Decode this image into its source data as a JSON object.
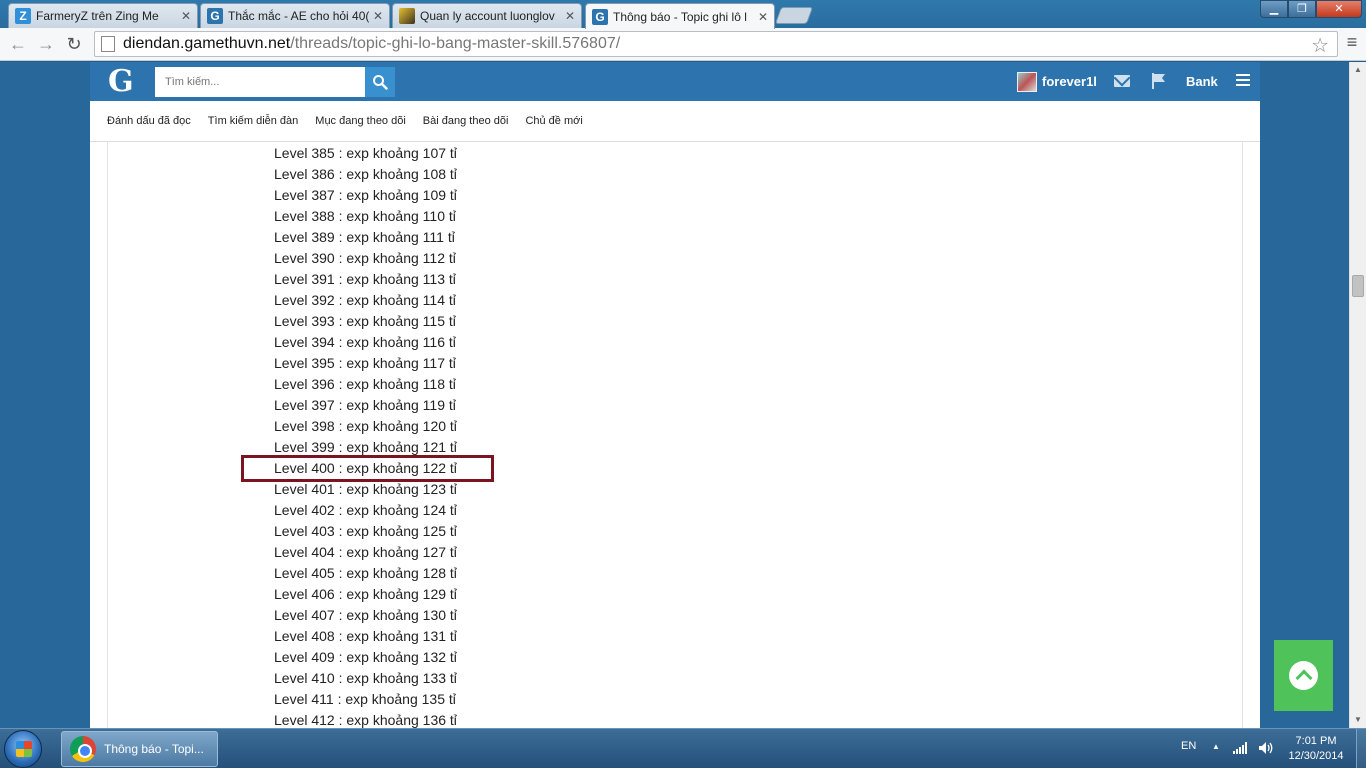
{
  "browser": {
    "tabs": [
      {
        "title": "FarmeryZ trên Zing Me",
        "favicon": "Z",
        "favicon_color": "#2f8fd8"
      },
      {
        "title": "Thắc mắc - AE cho hỏi 40(",
        "favicon": "G",
        "favicon_color": "#2d74ae"
      },
      {
        "title": "Quan ly account luonglov",
        "favicon": "",
        "favicon_color": "#3b3120"
      },
      {
        "title": "Thông báo - Topic ghi lô l",
        "favicon": "G",
        "favicon_color": "#2d74ae"
      }
    ],
    "url_domain": "diendan.gamethuvn.net",
    "url_path": "/threads/topic-ghi-lo-bang-master-skill.576807/"
  },
  "site": {
    "logo": "G",
    "search_placeholder": "Tìm kiếm...",
    "username": "forever1l",
    "bank_label": "Bank",
    "nav": [
      "Đánh dấu đã đọc",
      "Tìm kiếm diễn đàn",
      "Mục đang theo dõi",
      "Bài đang theo dõi",
      "Chủ đề mới"
    ],
    "highlighted_level": 400
  },
  "content": {
    "levels": [
      "Level 385 : exp khoảng 107 tỉ",
      "Level 386 : exp khoảng 108 tỉ",
      "Level 387 : exp khoảng 109 tỉ",
      "Level 388 : exp khoảng 110 tỉ",
      "Level 389 : exp khoảng 111 tỉ",
      "Level 390 : exp khoảng 112 tỉ",
      "Level 391 : exp khoảng 113 tỉ",
      "Level 392 : exp khoảng 114 tỉ",
      "Level 393 : exp khoảng 115 tỉ",
      "Level 394 : exp khoảng 116 tỉ",
      "Level 395 : exp khoảng 117 tỉ",
      "Level 396 : exp khoảng 118 tỉ",
      "Level 397 : exp khoảng 119 tỉ",
      "Level 398 : exp khoảng 120 tỉ",
      "Level 399 : exp khoảng 121 tỉ",
      "Level 400 : exp khoảng 122 tỉ",
      "Level 401 : exp khoảng 123 tỉ",
      "Level 402 : exp khoảng 124 tỉ",
      "Level 403 : exp khoảng 125 tỉ",
      "Level 404 : exp khoảng 127 tỉ",
      "Level 405 : exp khoảng 128 tỉ",
      "Level 406 : exp khoảng 129 tỉ",
      "Level 407 : exp khoảng 130 tỉ",
      "Level 408 : exp khoảng 131 tỉ",
      "Level 409 : exp khoảng 132 tỉ",
      "Level 410 : exp khoảng 133 tỉ",
      "Level 411 : exp khoảng 135 tỉ",
      "Level 412 : exp khoảng 136 tỉ"
    ]
  },
  "taskbar": {
    "task_label": "Thông báo - Topi...",
    "language": "EN",
    "time": "7:01 PM",
    "date": "12/30/2014"
  }
}
